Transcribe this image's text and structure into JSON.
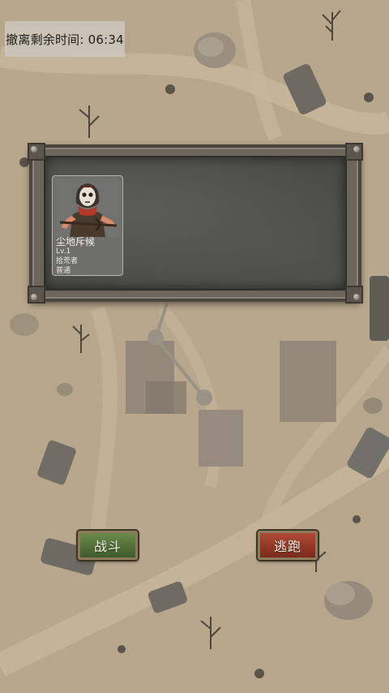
{
  "timer": {
    "label": "撤离剩余时间: 06:34"
  },
  "encounter": {
    "enemy": {
      "name": "尘地斥候",
      "level": "Lv.1",
      "type": "拾荒者",
      "rarity": "普通"
    }
  },
  "actions": {
    "fight_label": "战斗",
    "flee_label": "逃跑"
  },
  "colors": {
    "fight_button": "#4f6e38",
    "flee_button": "#9a3a28",
    "panel_bg": "#4a4b47"
  }
}
